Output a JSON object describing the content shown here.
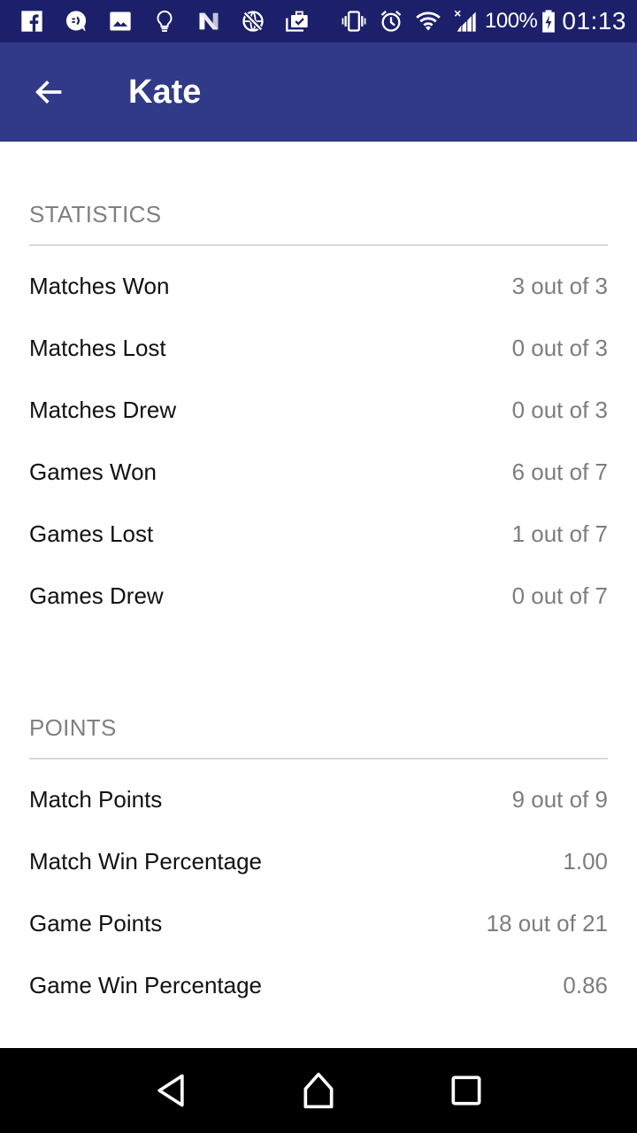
{
  "status_bar": {
    "left_icons": [
      "facebook-icon",
      "chat-bubble-icon",
      "image-icon",
      "lightbulb-icon",
      "n-app-icon",
      "network-off-icon",
      "briefcase-check-icon"
    ],
    "right_icons": [
      "vibrate-icon",
      "alarm-icon",
      "wifi-icon",
      "signal-icon"
    ],
    "battery_percent": "100%",
    "time": "01:13"
  },
  "toolbar": {
    "title": "Kate",
    "back_icon": "arrow-back-icon"
  },
  "sections": {
    "statistics": {
      "title": "STATISTICS",
      "rows": [
        {
          "label": "Matches Won",
          "value": "3 out of 3"
        },
        {
          "label": "Matches Lost",
          "value": "0 out of 3"
        },
        {
          "label": "Matches Drew",
          "value": "0 out of 3"
        },
        {
          "label": "Games Won",
          "value": "6 out of 7"
        },
        {
          "label": "Games Lost",
          "value": "1 out of 7"
        },
        {
          "label": "Games Drew",
          "value": "0 out of 7"
        }
      ]
    },
    "points": {
      "title": "POINTS",
      "rows": [
        {
          "label": "Match Points",
          "value": "9 out of 9"
        },
        {
          "label": "Match Win Percentage",
          "value": "1.00"
        },
        {
          "label": "Game Points",
          "value": "18 out of 21"
        },
        {
          "label": "Game Win Percentage",
          "value": "0.86"
        }
      ]
    }
  },
  "nav_bar": {
    "buttons": [
      "back-triangle-icon",
      "home-icon",
      "recents-square-icon"
    ]
  },
  "colors": {
    "status_bar": "#1c206b",
    "toolbar": "#313a88",
    "section_header": "#808080",
    "value_text": "#7d7d7d"
  }
}
